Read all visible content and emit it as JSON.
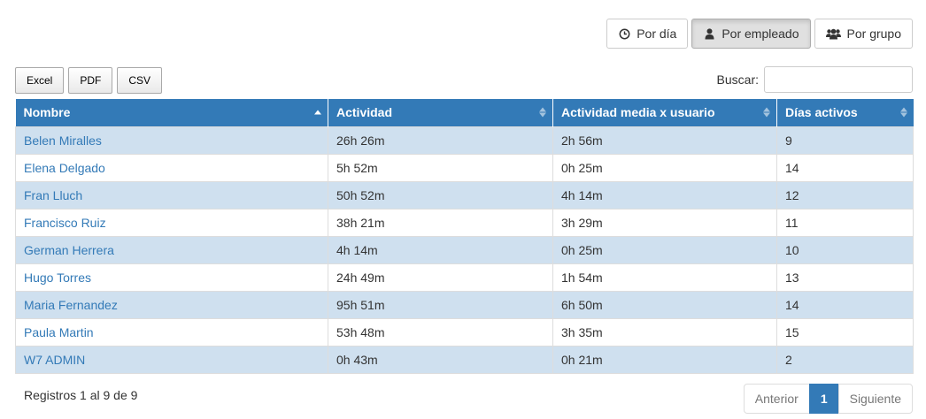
{
  "view_toggle": {
    "by_day": "Por día",
    "by_employee": "Por empleado",
    "by_group": "Por grupo",
    "active": "by_employee"
  },
  "export": {
    "excel": "Excel",
    "pdf": "PDF",
    "csv": "CSV"
  },
  "search": {
    "label": "Buscar:",
    "value": ""
  },
  "table": {
    "headers": [
      "Nombre",
      "Actividad",
      "Actividad media x usuario",
      "Días activos"
    ],
    "sorted_column": "Nombre",
    "sort_direction": "asc",
    "rows": [
      [
        "Belen Miralles",
        "26h 26m",
        "2h 56m",
        "9"
      ],
      [
        "Elena Delgado",
        "5h 52m",
        "0h 25m",
        "14"
      ],
      [
        "Fran Lluch",
        "50h 52m",
        "4h 14m",
        "12"
      ],
      [
        "Francisco Ruiz",
        "38h 21m",
        "3h 29m",
        "11"
      ],
      [
        "German Herrera",
        "4h 14m",
        "0h 25m",
        "10"
      ],
      [
        "Hugo Torres",
        "24h 49m",
        "1h 54m",
        "13"
      ],
      [
        "Maria Fernandez",
        "95h 51m",
        "6h 50m",
        "14"
      ],
      [
        "Paula Martin",
        "53h 48m",
        "3h 35m",
        "15"
      ],
      [
        "W7 ADMIN",
        "0h 43m",
        "0h 21m",
        "2"
      ]
    ]
  },
  "footer": {
    "info": "Registros 1 al 9 de 9",
    "prev": "Anterior",
    "current_page": "1",
    "next": "Siguiente"
  },
  "colors": {
    "header_bg": "#337ab7",
    "row_stripe": "#cfe0ef",
    "link": "#337ab7"
  }
}
